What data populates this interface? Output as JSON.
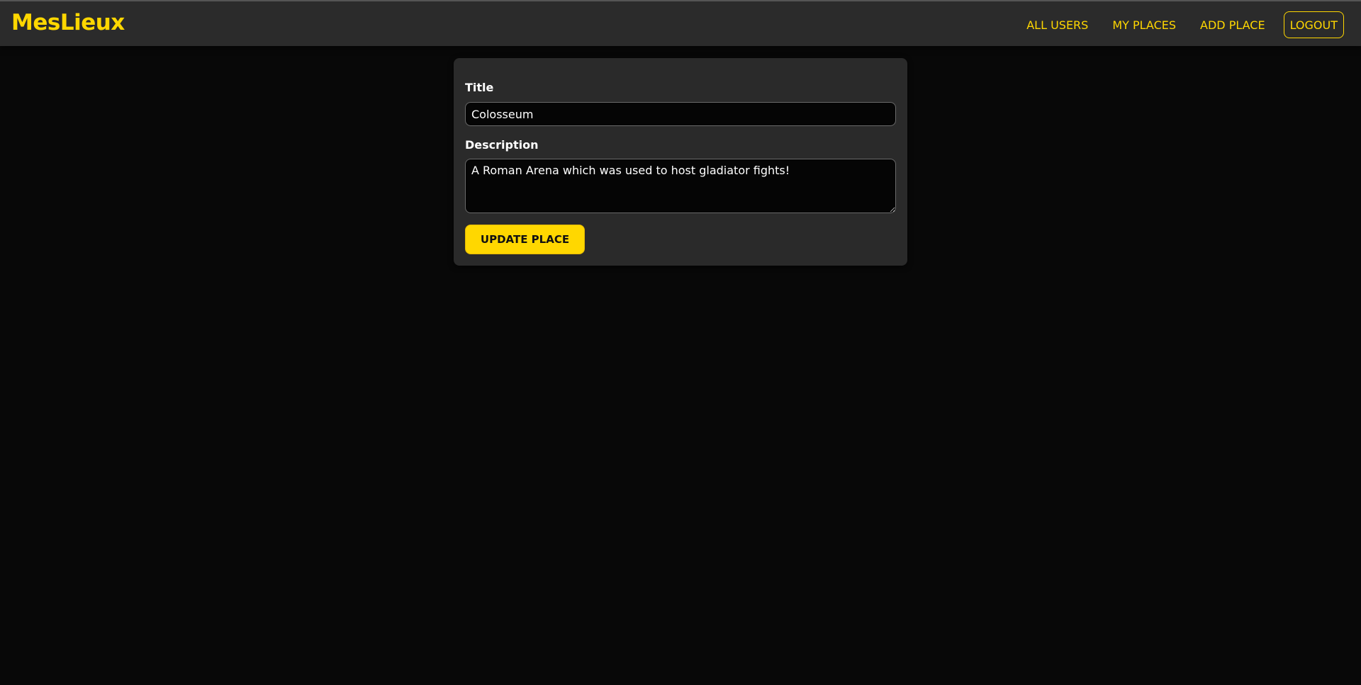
{
  "header": {
    "brand": "MesLieux",
    "nav": {
      "all_users": "ALL USERS",
      "my_places": "MY PLACES",
      "add_place": "ADD PLACE",
      "logout": "LOGOUT"
    }
  },
  "form": {
    "title_label": "Title",
    "title_value": "Colosseum",
    "description_label": "Description",
    "description_value": "A Roman Arena which was used to host gladiator fights!",
    "submit_label": "UPDATE PLACE"
  },
  "colors": {
    "accent": "#ffd700",
    "background": "#080808",
    "header_bg": "#2b2b2b",
    "card_bg": "#2a2a2a"
  }
}
